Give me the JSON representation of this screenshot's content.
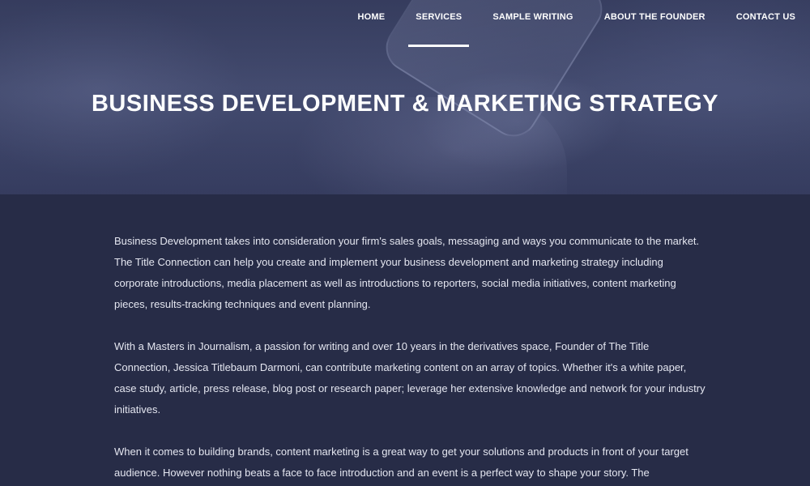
{
  "nav": {
    "items": [
      {
        "label": "HOME",
        "active": false
      },
      {
        "label": "SERVICES",
        "active": true
      },
      {
        "label": "SAMPLE WRITING",
        "active": false
      },
      {
        "label": "ABOUT THE FOUNDER",
        "active": false
      },
      {
        "label": "CONTACT US",
        "active": false
      }
    ]
  },
  "hero": {
    "title": "BUSINESS DEVELOPMENT & MARKETING STRATEGY"
  },
  "content": {
    "paragraphs": [
      "Business Development takes into consideration your firm's sales goals, messaging and ways you communicate to the market. The Title Connection can help you create and implement your business development and marketing strategy including corporate introductions, media placement as well as introductions to reporters, social media initiatives, content marketing pieces, results-tracking techniques and event planning.",
      "With a Masters in Journalism, a passion for writing and over 10 years in the derivatives space, Founder of The Title Connection, Jessica Titlebaum Darmoni, can contribute marketing content on an array of topics.  Whether it's a white paper, case study, article, press release, blog post or research paper; leverage her extensive knowledge and network for your industry initiatives.",
      "When it comes to building brands, content marketing is a great way to get your solutions and products in front of your target audience.  However nothing beats a face to face introduction and an event is a perfect way to shape your story.  The"
    ]
  },
  "colors": {
    "background": "#272c47",
    "hero_tint": "#474f74",
    "text": "#e4e6f0",
    "nav_text": "#ffffff"
  }
}
